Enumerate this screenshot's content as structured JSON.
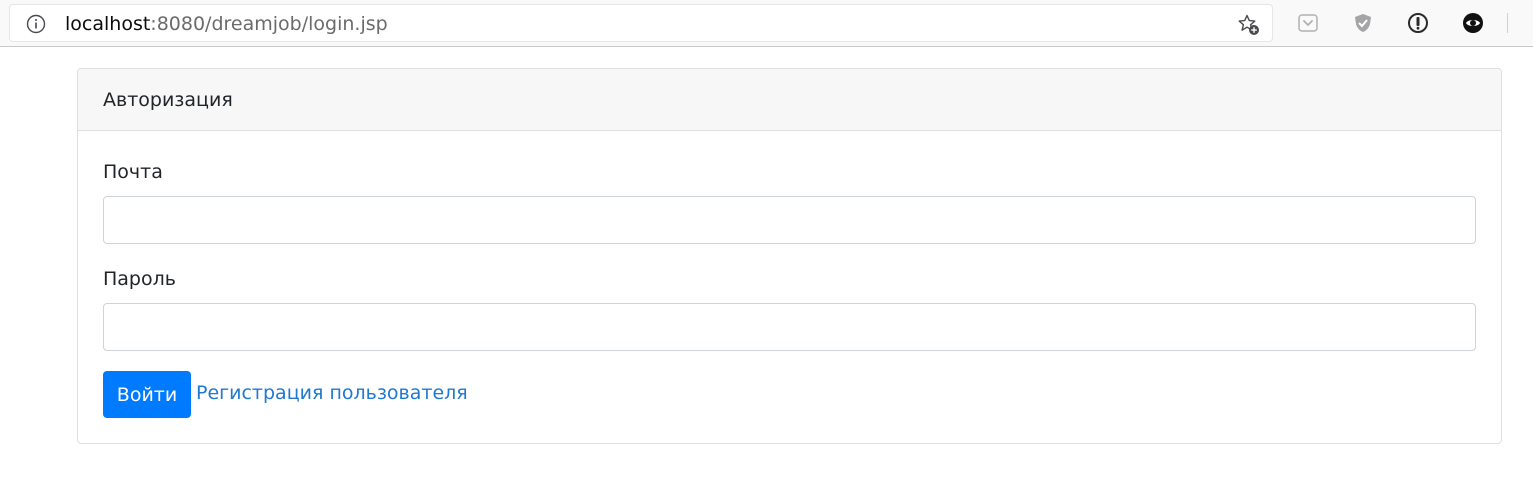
{
  "browser": {
    "url_host": "localhost",
    "url_rest": ":8080/dreamjob/login.jsp",
    "icons": [
      "info-icon",
      "star-add-icon",
      "pocket-icon",
      "shield-icon",
      "password-manager-icon",
      "sync-icon"
    ]
  },
  "card": {
    "title": "Авторизация",
    "email_label": "Почта",
    "email_value": "",
    "password_label": "Пароль",
    "password_value": "",
    "login_button": "Войти",
    "register_link": "Регистрация пользователя"
  },
  "colors": {
    "primary": "#007bff",
    "link": "#1f78d1",
    "header_bg": "#f7f7f7",
    "border": "#dfdfdf"
  }
}
